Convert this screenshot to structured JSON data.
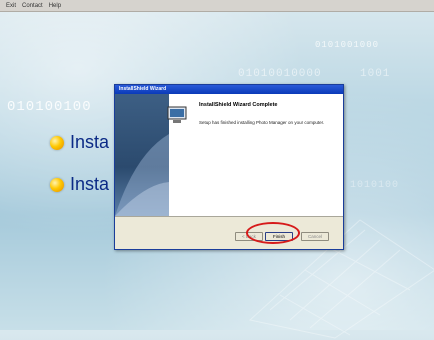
{
  "menu": {
    "items": [
      "Exit",
      "Contact",
      "Help"
    ]
  },
  "background": {
    "binary": [
      "0101001000",
      "01010010000",
      "1001",
      "010100100",
      "1010100"
    ]
  },
  "install_items": [
    {
      "label": "Insta"
    },
    {
      "label": "Insta"
    }
  ],
  "dialog": {
    "title": "InstallShield Wizard",
    "heading": "InstallShield Wizard Complete",
    "message": "Setup has finished installing Photo Manager on your computer.",
    "buttons": {
      "back": "< Back",
      "finish": "Finish",
      "cancel": "Cancel"
    }
  },
  "colors": {
    "accent_blue": "#0b2a86",
    "highlight_red": "#d61a1a",
    "title_blue": "#0a3ab8"
  },
  "icons": {
    "bullet": "orange-bullet-icon",
    "setup": "installshield-monitor-icon"
  }
}
